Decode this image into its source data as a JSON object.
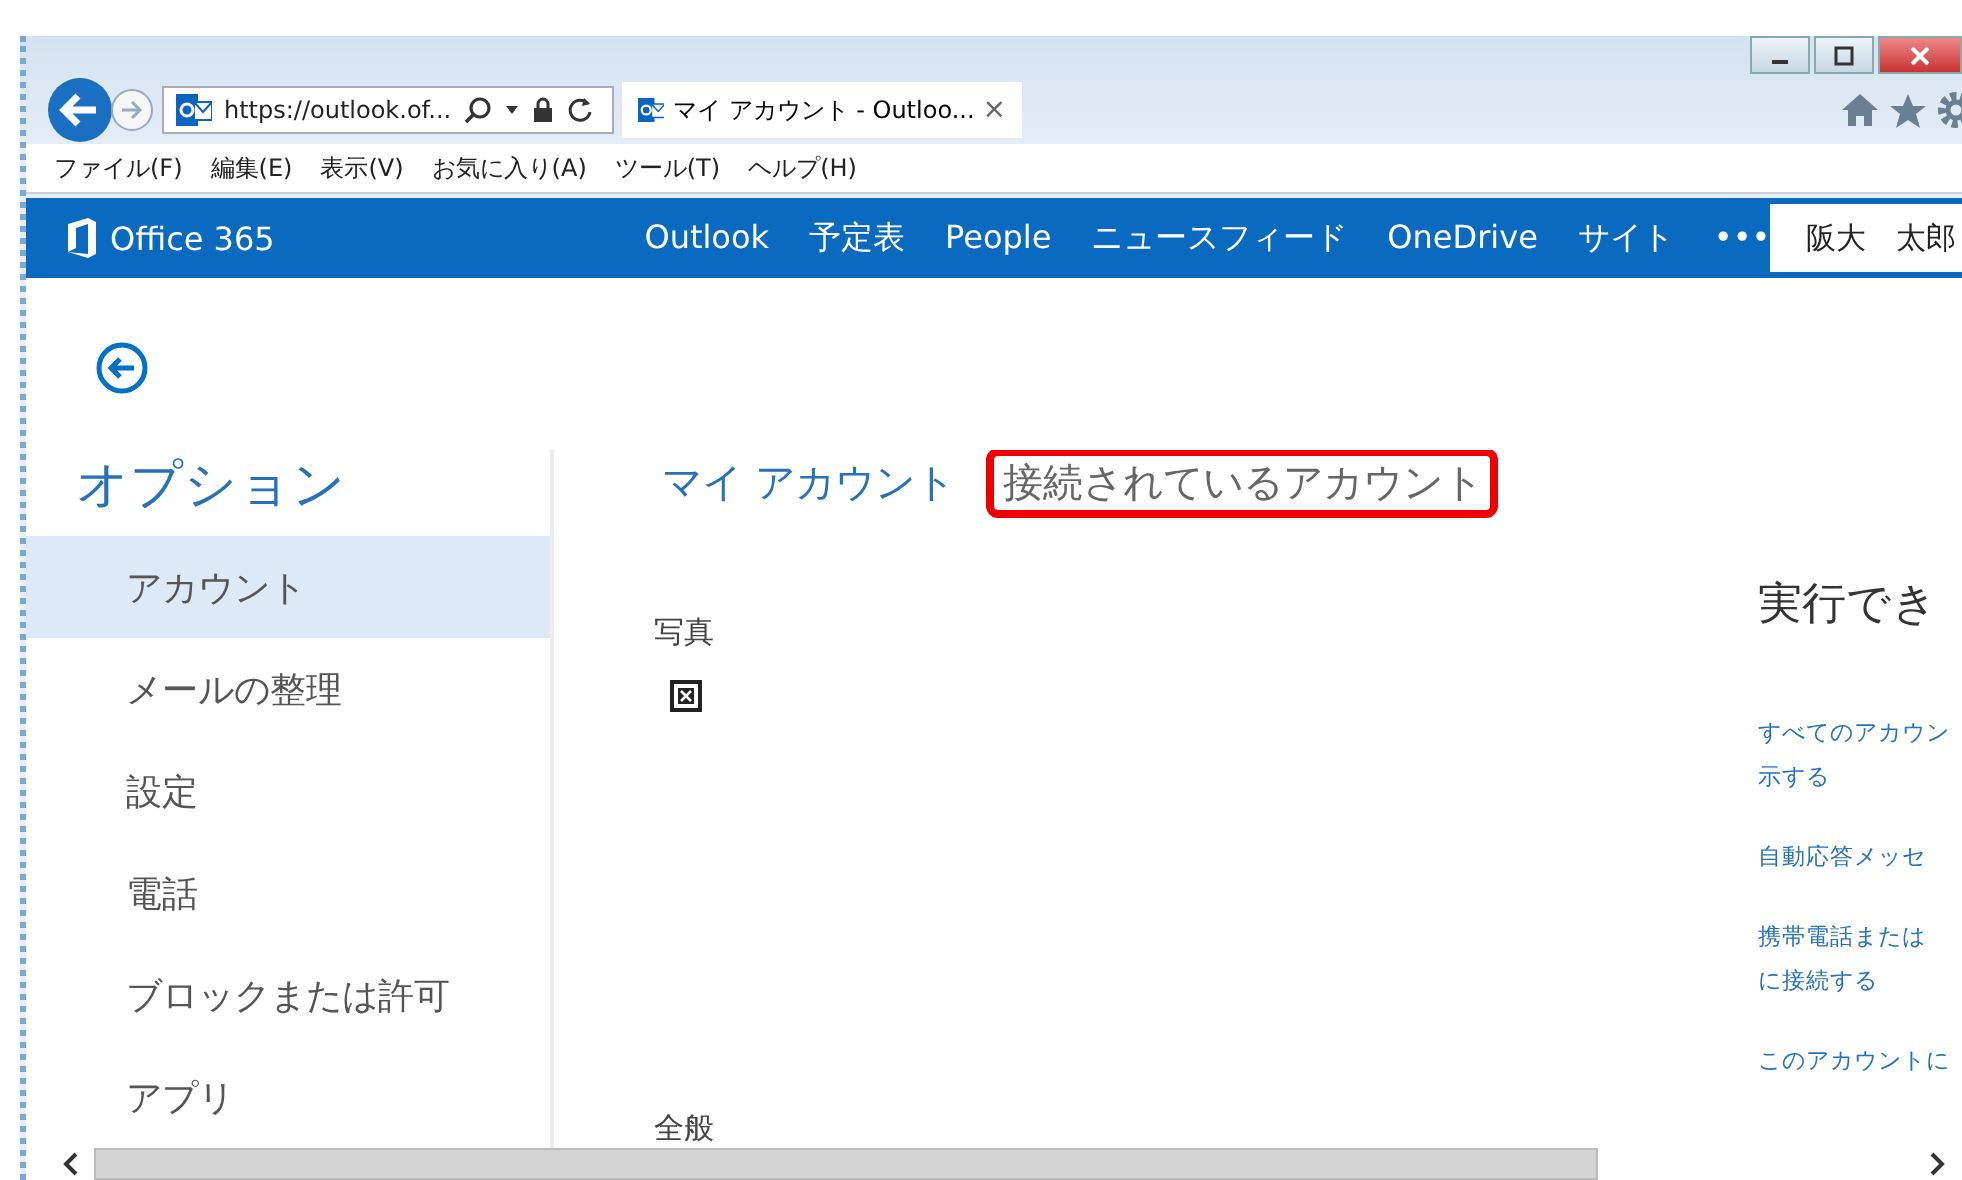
{
  "browser": {
    "address": "https://outlook.of...",
    "tab": {
      "title": "マイ アカウント - Outloo...",
      "close": "×"
    },
    "menu": [
      "ファイル(F)",
      "編集(E)",
      "表示(V)",
      "お気に入り(A)",
      "ツール(T)",
      "ヘルプ(H)"
    ]
  },
  "suite_bar": {
    "brand": "Office 365",
    "nav": [
      {
        "label": "Outlook"
      },
      {
        "label": "予定表"
      },
      {
        "label": "People"
      },
      {
        "label": "ニュースフィード"
      },
      {
        "label": "OneDrive"
      },
      {
        "label": "サイト"
      },
      {
        "label": "•••"
      }
    ],
    "user": "阪大　太郎"
  },
  "sidebar": {
    "title": "オプション",
    "items": [
      {
        "label": "アカウント",
        "selected": true
      },
      {
        "label": "メールの整理",
        "selected": false
      },
      {
        "label": "設定",
        "selected": false
      },
      {
        "label": "電話",
        "selected": false
      },
      {
        "label": "ブロックまたは許可",
        "selected": false
      },
      {
        "label": "アプリ",
        "selected": false
      }
    ]
  },
  "tabs": [
    {
      "label": "マイ アカウント",
      "selected": false,
      "highlighted": false
    },
    {
      "label": "接続されているアカウント",
      "selected": true,
      "highlighted": true
    }
  ],
  "content": {
    "photo_label": "写真",
    "general_label": "全般"
  },
  "actions": {
    "title": "実行でき",
    "links": [
      {
        "lines": [
          "すべてのアカウン",
          "示する"
        ]
      },
      {
        "lines": [
          "自動応答メッセ"
        ]
      },
      {
        "lines": [
          "携帯電話または",
          "に接続する"
        ]
      },
      {
        "lines": [
          "このアカウントに"
        ]
      }
    ]
  }
}
